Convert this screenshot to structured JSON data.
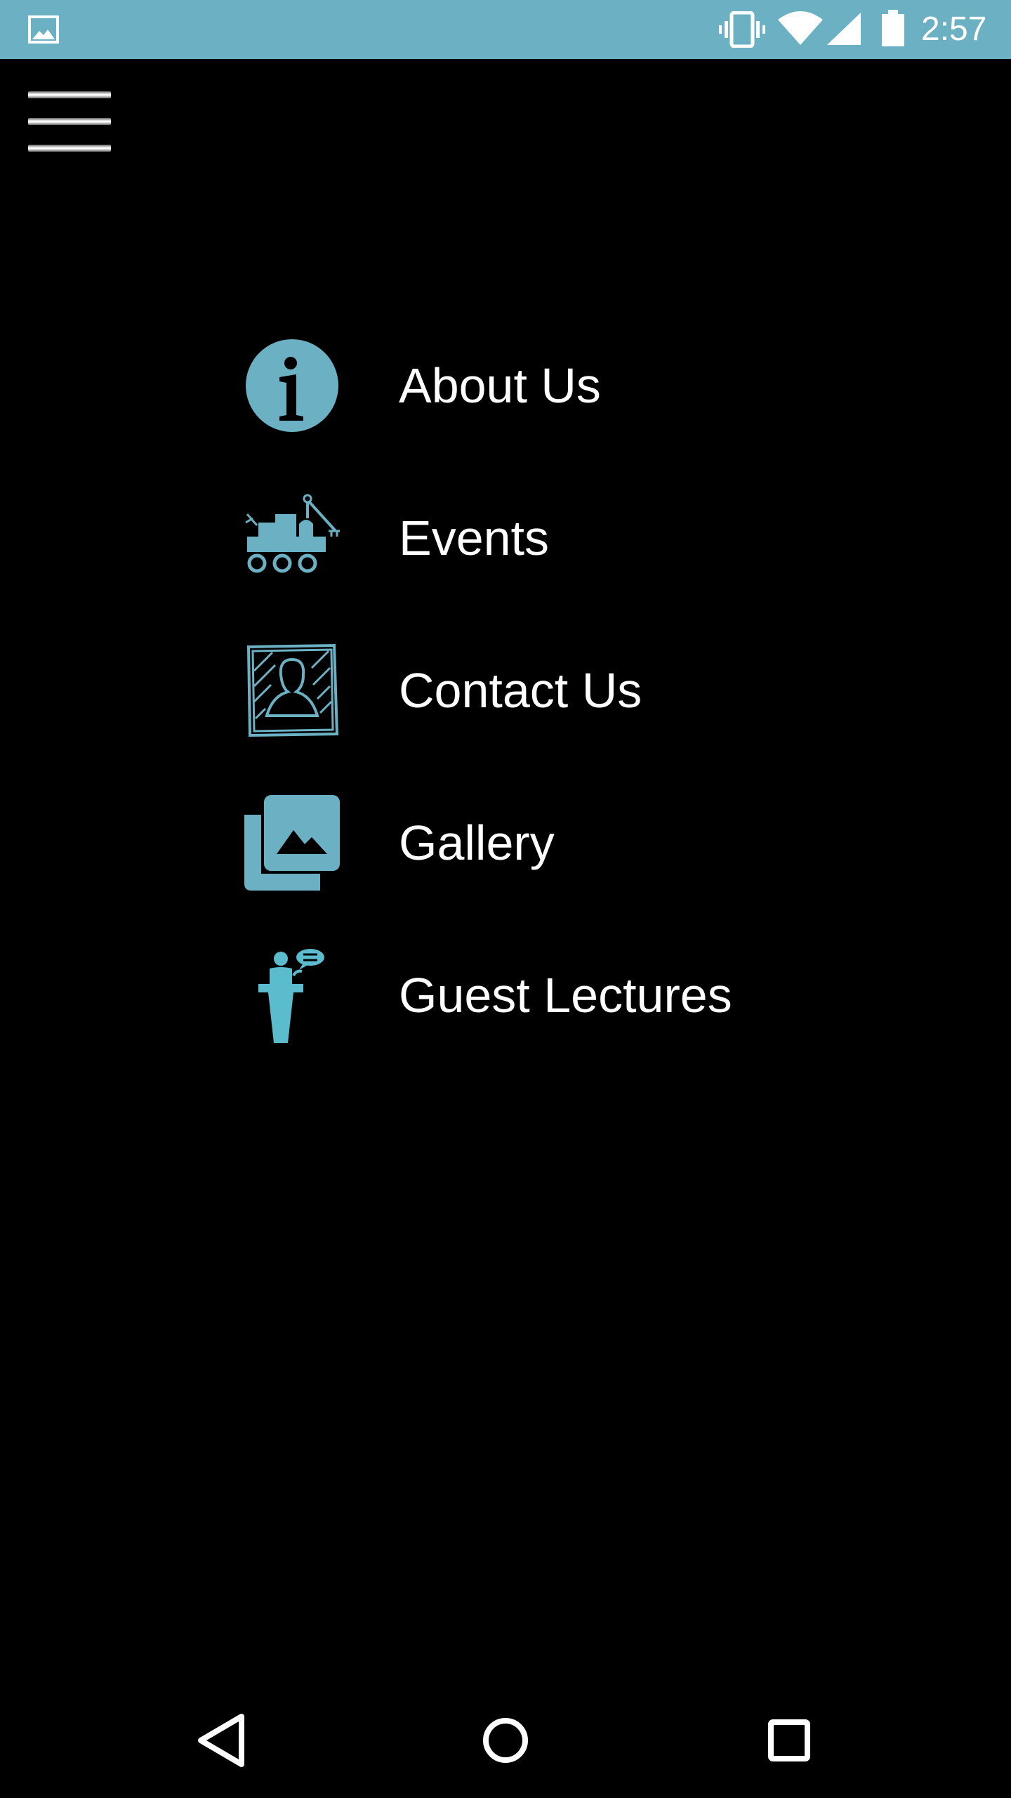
{
  "status_bar": {
    "time": "2:57",
    "background": "#6bb0c3",
    "icons": [
      "image-notification-icon",
      "vibrate-icon",
      "wifi-icon",
      "signal-icon",
      "battery-icon"
    ]
  },
  "app_bar": {
    "menu_icon": "hamburger-menu-icon"
  },
  "menu": {
    "accent_color": "#6bb0c3",
    "items": [
      {
        "label": "About Us",
        "icon": "info-icon"
      },
      {
        "label": "Events",
        "icon": "rover-icon"
      },
      {
        "label": "Contact Us",
        "icon": "contact-card-icon"
      },
      {
        "label": "Gallery",
        "icon": "gallery-icon"
      },
      {
        "label": "Guest Lectures",
        "icon": "lecturer-podium-icon"
      }
    ]
  },
  "nav_bar": {
    "buttons": [
      "back-icon",
      "home-icon",
      "recents-icon"
    ]
  }
}
